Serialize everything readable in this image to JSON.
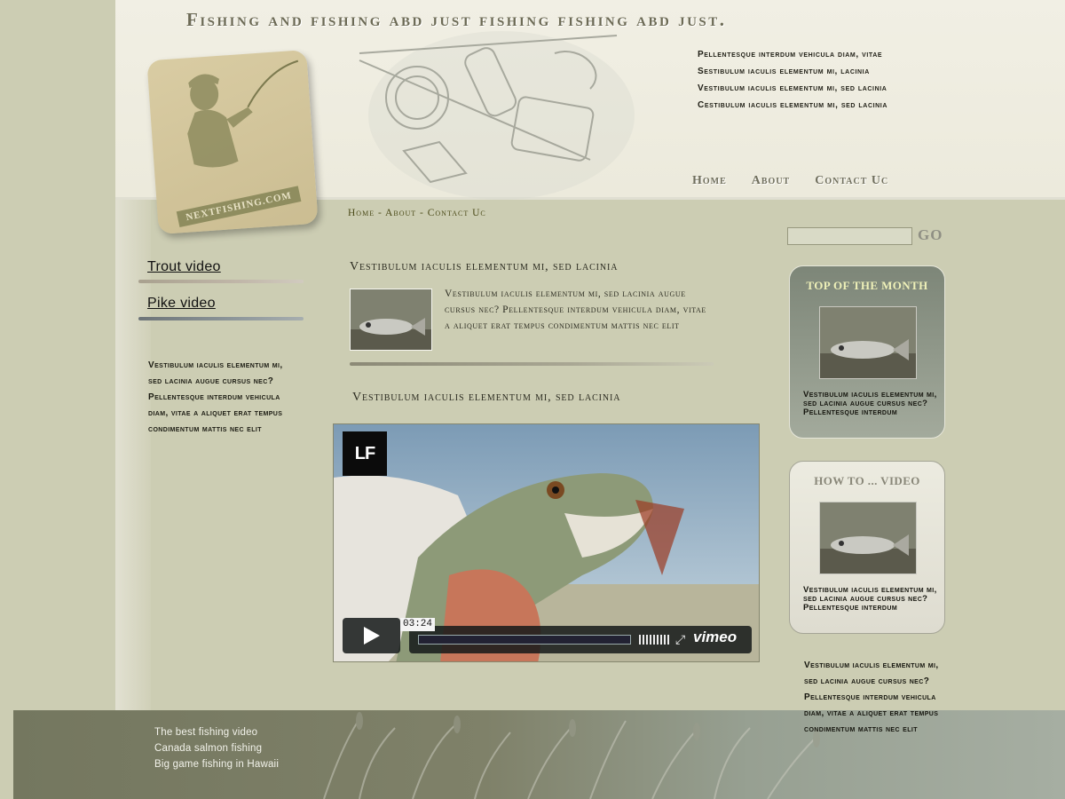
{
  "site_title": "Fishing and fishing abd just fishing fishing abd just.",
  "logo": {
    "text": "NEXTFISHING.COM"
  },
  "header_notes": [
    "Pellentesque interdum vehicula diam, vitae",
    "Sestibulum iaculis elementum mi, lacinia",
    "Vestibulum iaculis elementum mi, sed lacinia",
    "Cestibulum iaculis elementum mi, sed lacinia"
  ],
  "top_nav": [
    "Home",
    "About",
    "Contact Uc"
  ],
  "breadcrumb": {
    "home": "Home",
    "sep": " - ",
    "about": "About",
    "contact": "Contact Uc"
  },
  "sidebar": {
    "links": [
      "Trout video",
      "Pike video"
    ],
    "text": "Vestibulum iaculis elementum mi, sed lacinia augue cursus nec? Pellentesque interdum vehicula diam, vitae a aliquet erat tempus condimentum mattis nec elit"
  },
  "article": {
    "heading": "Vestibulum iaculis elementum mi, sed lacinia",
    "body": "Vestibulum iaculis elementum mi, sed lacinia augue cursus nec? Pellentesque interdum vehicula diam, vitae a aliquet erat tempus condimentum mattis nec elit",
    "video_heading": "Vestibulum iaculis elementum mi, sed lacinia"
  },
  "video": {
    "badge": "LF",
    "timecode": "03:24",
    "brand": "vimeo"
  },
  "search": {
    "placeholder": "",
    "button": "GO"
  },
  "widgets": [
    {
      "title": "TOP OF THE MONTH",
      "text": "Vestibulum iaculis elementum mi, sed lacinia augue cursus nec? Pellentesque interdum"
    },
    {
      "title": "HOW TO ... VIDEO",
      "text": "Vestibulum iaculis elementum mi, sed lacinia augue cursus nec? Pellentesque interdum"
    }
  ],
  "right_text": "Vestibulum iaculis elementum mi, sed lacinia augue cursus nec? Pellentesque interdum vehicula diam, vitae a aliquet erat tempus condimentum mattis nec elit",
  "footer_links": [
    "The best fishing video",
    "Canada salmon fishing",
    "Big game fishing in Hawaii"
  ],
  "colors": {
    "page_bg": "#cccdb3",
    "header_bg": "#f1efe4",
    "accent_olive": "#4a4a18",
    "footer_bg": "#7f8169"
  },
  "icons": [
    "fisherman-logo-icon",
    "fishing-gear-sketch-icon",
    "play-icon",
    "volume-icon",
    "fullscreen-icon",
    "grass-icon"
  ]
}
